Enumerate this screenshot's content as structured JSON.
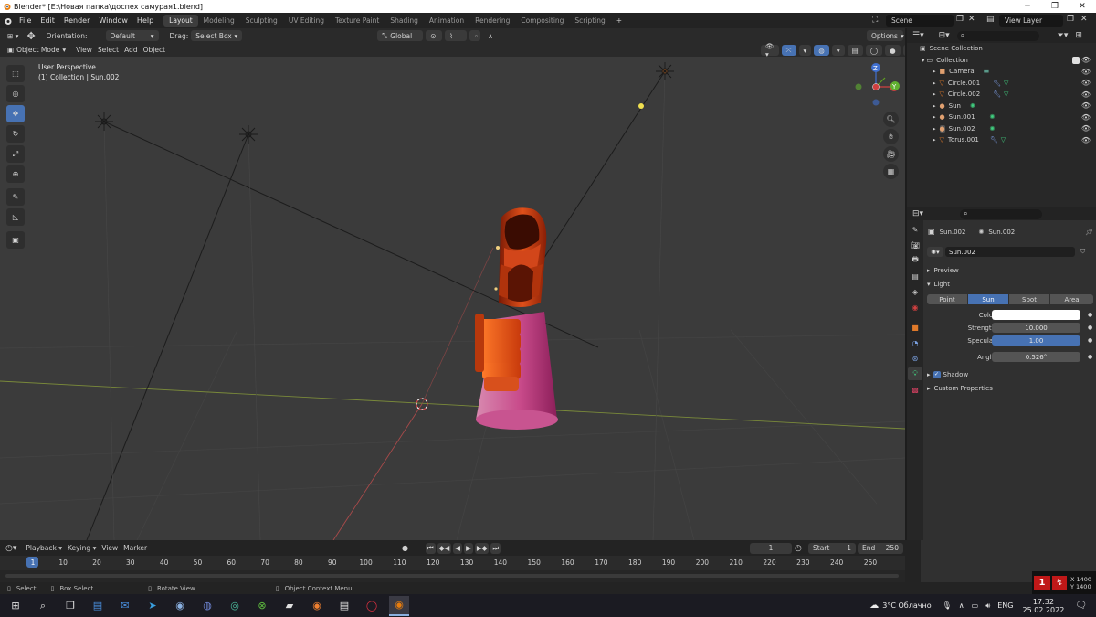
{
  "window": {
    "title": "Blender* [E:\\Новая папка\\доспех самурая1.blend]",
    "minimize": "─",
    "maximize": "❐",
    "close": "✕"
  },
  "menu": [
    "File",
    "Edit",
    "Render",
    "Window",
    "Help"
  ],
  "workspaces": [
    "Layout",
    "Modeling",
    "Sculpting",
    "UV Editing",
    "Texture Paint",
    "Shading",
    "Animation",
    "Rendering",
    "Compositing",
    "Scripting"
  ],
  "add_workspace": "+",
  "scene": "Scene",
  "view_layer": "View Layer",
  "viewport": {
    "header": {
      "orientation_label": "Orientation:",
      "orientation_value": "Default",
      "drag_label": "Drag:",
      "drag_value": "Select Box",
      "transform_space": "Global",
      "options": "Options"
    },
    "header2": {
      "mode": "Object Mode",
      "view": "View",
      "select": "Select",
      "add": "Add",
      "object": "Object"
    },
    "perspective_label": "User Perspective",
    "context_label": "(1) Collection | Sun.002",
    "gizmo": {
      "x": "X",
      "y": "Y",
      "z": "Z"
    }
  },
  "outliner": {
    "root": "Scene Collection",
    "collection": "Collection",
    "items": [
      {
        "name": "Camera"
      },
      {
        "name": "Circle.001"
      },
      {
        "name": "Circle.002"
      },
      {
        "name": "Sun"
      },
      {
        "name": "Sun.001"
      },
      {
        "name": "Sun.002"
      },
      {
        "name": "Torus.001"
      }
    ]
  },
  "properties": {
    "breadcrumb_object": "Sun.002",
    "breadcrumb_data": "Sun.002",
    "datablock": "Sun.002",
    "preview": "Preview",
    "light": "Light",
    "light_types": [
      "Point",
      "Sun",
      "Spot",
      "Area"
    ],
    "selected_type": "Sun",
    "color_label": "Color",
    "strength_label": "Strength",
    "strength_value": "10.000",
    "specular_label": "Specular",
    "specular_value": "1.00",
    "angle_label": "Angle",
    "angle_value": "0.526°",
    "shadow": "Shadow",
    "custom_properties": "Custom Properties",
    "light_color": "#ffffff"
  },
  "timeline": {
    "playback": "Playback",
    "keying": "Keying",
    "view": "View",
    "marker": "Marker",
    "current_frame": "1",
    "start_label": "Start",
    "start_value": "1",
    "end_label": "End",
    "end_value": "250",
    "ruler": [
      "1",
      "10",
      "20",
      "30",
      "40",
      "50",
      "60",
      "70",
      "80",
      "90",
      "100",
      "110",
      "120",
      "130",
      "140",
      "150",
      "160",
      "170",
      "180",
      "190",
      "200",
      "210",
      "220",
      "230",
      "240",
      "250"
    ]
  },
  "statusbar": {
    "select": "Select",
    "box_select": "Box Select",
    "rotate_view": "Rotate View",
    "context_menu": "Object Context Menu"
  },
  "taskbar": {
    "weather": "3°C Облачно",
    "language": "ENG",
    "time": "17:32",
    "date": "25.02.2022",
    "coords_x": "X 1400",
    "coords_y": "Y 1400"
  },
  "colors": {
    "accent": "#4772b3",
    "viewport_bg": "#3b3b3b",
    "armor_orange": "#c83a0c",
    "skirt_pink": "#c84a8a"
  }
}
